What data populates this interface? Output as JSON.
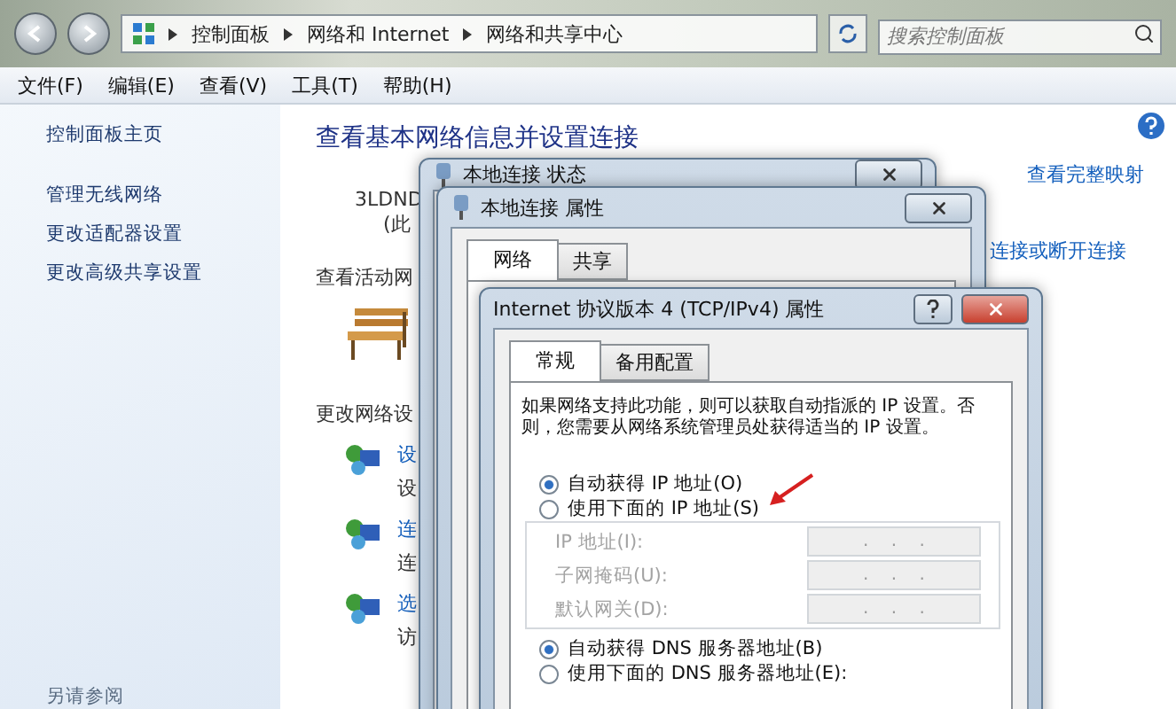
{
  "nav": {
    "breadcrumb": [
      "控制面板",
      "网络和 Internet",
      "网络和共享中心"
    ],
    "search": {
      "placeholder": "搜索控制面板"
    }
  },
  "menu": [
    "文件(F)",
    "编辑(E)",
    "查看(V)",
    "工具(T)",
    "帮助(H)"
  ],
  "sidebar": {
    "items": [
      "控制面板主页",
      "管理无线网络",
      "更改适配器设置",
      "更改高级共享设置"
    ],
    "see_also": "另请参阅"
  },
  "main": {
    "title": "查看基本网络信息并设置连接",
    "map_link": "查看完整映射",
    "computer": "3LDND",
    "computer_note": "(此",
    "active_heading": "查看活动网",
    "connect_link": "连接或断开连接",
    "change_heading": "更改网络设",
    "tasks": [
      {
        "link": "设",
        "desc": "设"
      },
      {
        "link": "连",
        "desc": "连"
      },
      {
        "link": "选",
        "desc": "访"
      }
    ]
  },
  "status_dialog": {
    "title": "本地连接 状态"
  },
  "properties_dialog": {
    "title": "本地连接 属性",
    "tabs": [
      {
        "label": "网络",
        "selected": true
      },
      {
        "label": "共享",
        "selected": false
      }
    ]
  },
  "ipv4_dialog": {
    "title": "Internet 协议版本 4 (TCP/IPv4) 属性",
    "tabs": [
      {
        "label": "常规",
        "selected": true
      },
      {
        "label": "备用配置",
        "selected": false
      }
    ],
    "description": "如果网络支持此功能，则可以获取自动指派的 IP 设置。否则，您需要从网络系统管理员处获得适当的 IP 设置。",
    "ip_options": [
      {
        "label": "自动获得 IP 地址(O)",
        "selected": true
      },
      {
        "label": "使用下面的 IP 地址(S)",
        "selected": false
      }
    ],
    "ip_fields": [
      {
        "label": "IP 地址(I):",
        "value": ".    .    .",
        "disabled": true
      },
      {
        "label": "子网掩码(U):",
        "value": ".    .    .",
        "disabled": true
      },
      {
        "label": "默认网关(D):",
        "value": ".    .    .",
        "disabled": true
      }
    ],
    "dns_options": [
      {
        "label": "自动获得 DNS 服务器地址(B)",
        "selected": true
      },
      {
        "label": "使用下面的 DNS 服务器地址(E):",
        "selected": false
      }
    ]
  }
}
